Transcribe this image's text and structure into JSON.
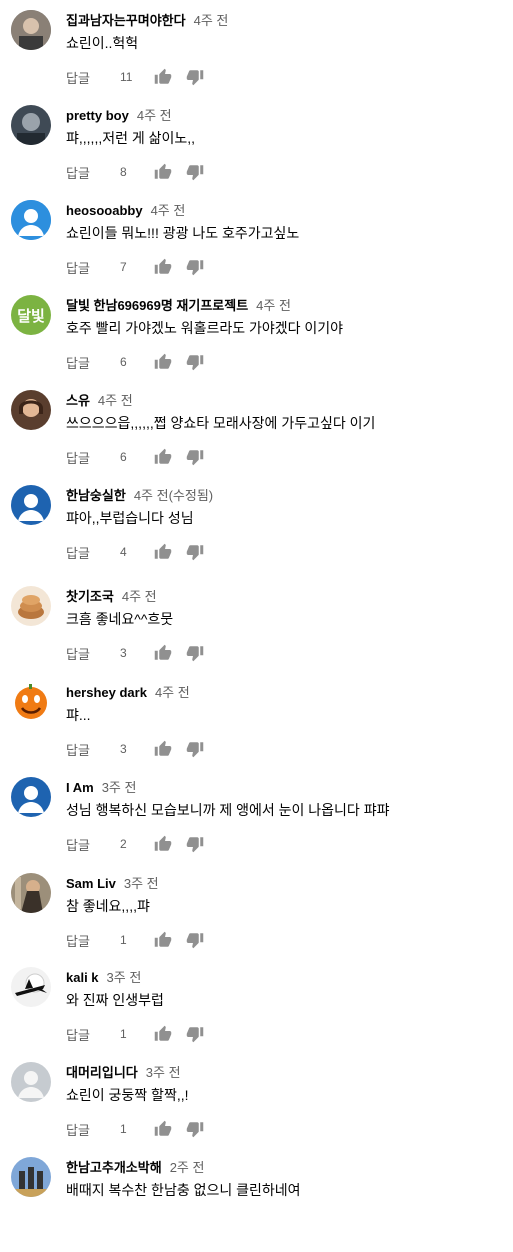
{
  "colors": {
    "author": "#030303",
    "meta": "#606060",
    "icon": "#909090",
    "default_avatar": "#1e63b0",
    "letter_avatar": "#7cb342"
  },
  "labels": {
    "reply": "답글"
  },
  "comments": [
    {
      "author": "집과남자는꾸며야한다",
      "time": "4주 전",
      "text": "쇼린이..헉헉",
      "likes": "11",
      "avatar": "photo-avatar"
    },
    {
      "author": "pretty boy",
      "time": "4주 전",
      "text": "퍄,,,,,,저런 게 삶이노,,",
      "likes": "8",
      "avatar": "photo-avatar"
    },
    {
      "author": "heosooabby",
      "time": "4주 전",
      "text": "쇼린이들 뭐노!!! 광광 나도 호주가고싶노",
      "likes": "7",
      "avatar": "default-avatar"
    },
    {
      "author": "달빛 한남696969명 재기프로젝트",
      "time": "4주 전",
      "text": "호주 빨리 가야겠노 워홀르라도 가야겠다 이기야",
      "likes": "6",
      "avatar": "letter-avatar",
      "avatar_letter": "달빛"
    },
    {
      "author": "스유",
      "time": "4주 전",
      "text": "쓰으으으읍,,,,,,쩝 양쇼타 모래사장에 가두고싶다 이기",
      "likes": "6",
      "avatar": "photo-avatar"
    },
    {
      "author": "한남숭실한",
      "time": "4주 전(수정됨)",
      "text": "퍄아,,부럽습니다 성님",
      "likes": "4",
      "avatar": "default-avatar"
    },
    {
      "author": "찻기조국",
      "time": "4주 전",
      "text": "크흠 좋네요^^흐뭇",
      "likes": "3",
      "avatar": "photo-avatar"
    },
    {
      "author": "hershey dark",
      "time": "4주 전",
      "text": "퍄...",
      "likes": "3",
      "avatar": "orange-avatar"
    },
    {
      "author": "I Am",
      "time": "3주 전",
      "text": "성님 행복하신 모습보니까 제 앵에서 눈이 나옵니다 퍄퍄",
      "likes": "2",
      "avatar": "default-avatar"
    },
    {
      "author": "Sam Liv",
      "time": "3주 전",
      "text": "참 좋네요,,,,퍄",
      "likes": "1",
      "avatar": "photo-avatar"
    },
    {
      "author": "kali k",
      "time": "3주 전",
      "text": "와 진짜 인생부럽",
      "likes": "1",
      "avatar": "witch-avatar"
    },
    {
      "author": "대머리입니다",
      "time": "3주 전",
      "text": "쇼린이 궁둥짝 할짝,,!",
      "likes": "1",
      "avatar": "gray-default-avatar"
    },
    {
      "author": "한남고추개소박해",
      "time": "2주 전",
      "text": "배때지 복수찬 한남충 없으니 클린하네여",
      "likes": "",
      "avatar": "photo-avatar"
    }
  ]
}
